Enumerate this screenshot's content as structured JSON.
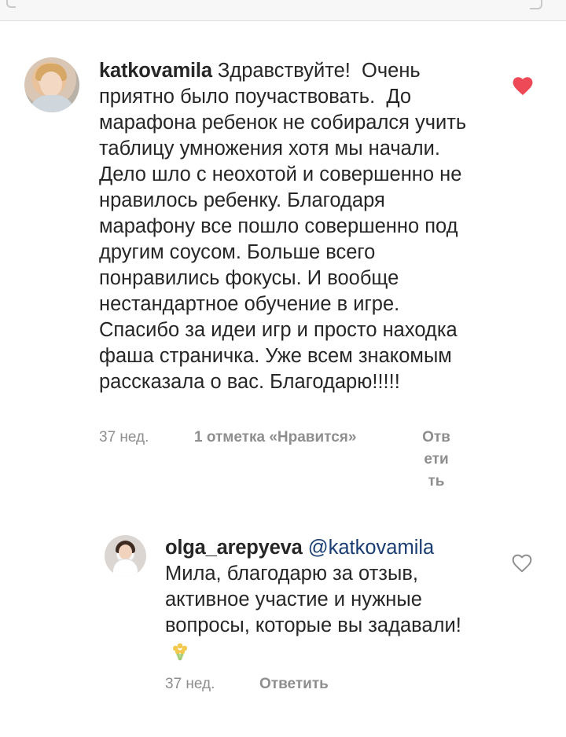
{
  "comments": [
    {
      "username": "katkovamila",
      "text": "Здравствуйте!  Очень приятно было поучаствовать.  До марафона ребенок не собирался учить таблицу умножения хотя мы начали. Дело шло с неохотой и совершенно не нравилось ребенку. Благодаря марафону все пошло совершенно под другим соусом. Больше всего понравились фокусы. И вообще нестандартное обучение в игре. Спасибо за идеи игр и просто находка фаша страничка. Уже всем знакомым рассказала о вас. Благодарю!!!!!",
      "time": "37 нед.",
      "likes": "1 отметка «Нравится»",
      "reply": "Отв\nети\nть",
      "liked": true
    },
    {
      "username": "olga_arepyeva",
      "mention": "@katkovamila",
      "text": "Мила, благодарю за отзыв, активное участие и нужные вопросы, которые вы задавали!",
      "time": "37 нед.",
      "reply": "Ответить",
      "liked": false
    }
  ],
  "icons": {
    "heart_filled": "heart-filled-icon",
    "heart_outline": "heart-outline-icon",
    "flowers": "bouquet-emoji"
  },
  "colors": {
    "heart": "#ed4956",
    "text": "#262626",
    "muted": "#8e8e8e",
    "mention": "#1a3d73"
  }
}
